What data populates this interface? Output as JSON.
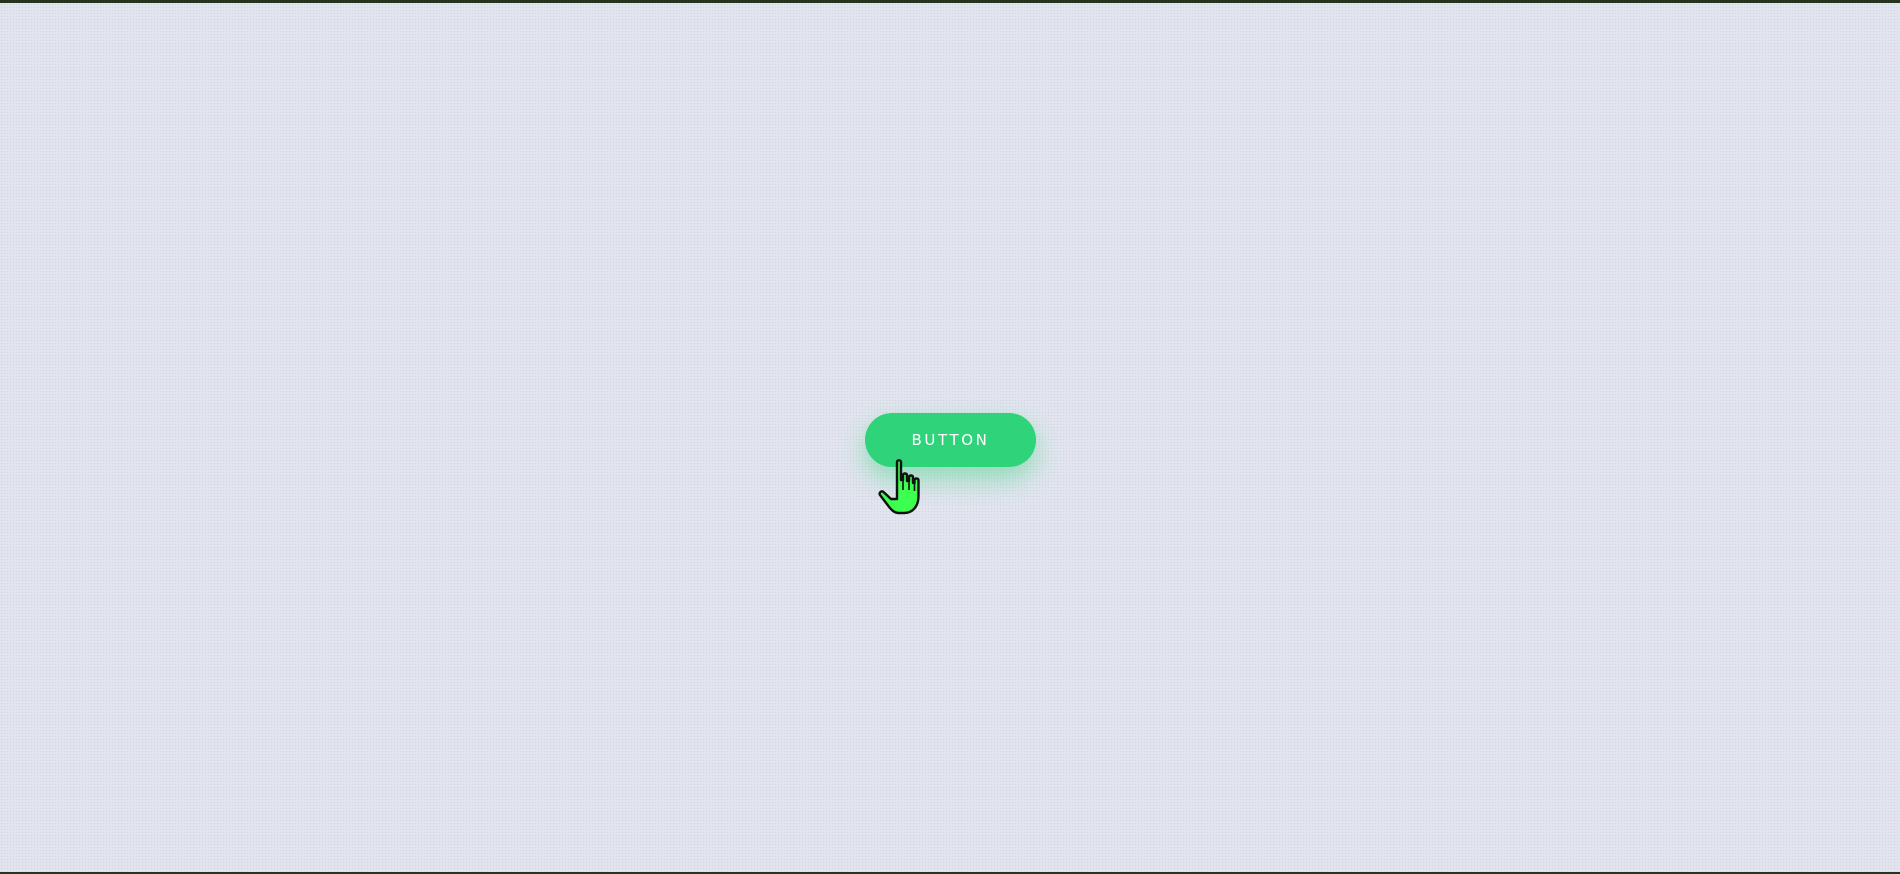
{
  "button": {
    "label": "BUTTON"
  },
  "colors": {
    "background": "#e2e5ee",
    "button_fill": "#2fd37a",
    "button_text": "#ffffff",
    "cursor_fill": "#3cff4f",
    "frame": "#26331f"
  },
  "cursor": {
    "icon": "pointer-hand-icon"
  }
}
